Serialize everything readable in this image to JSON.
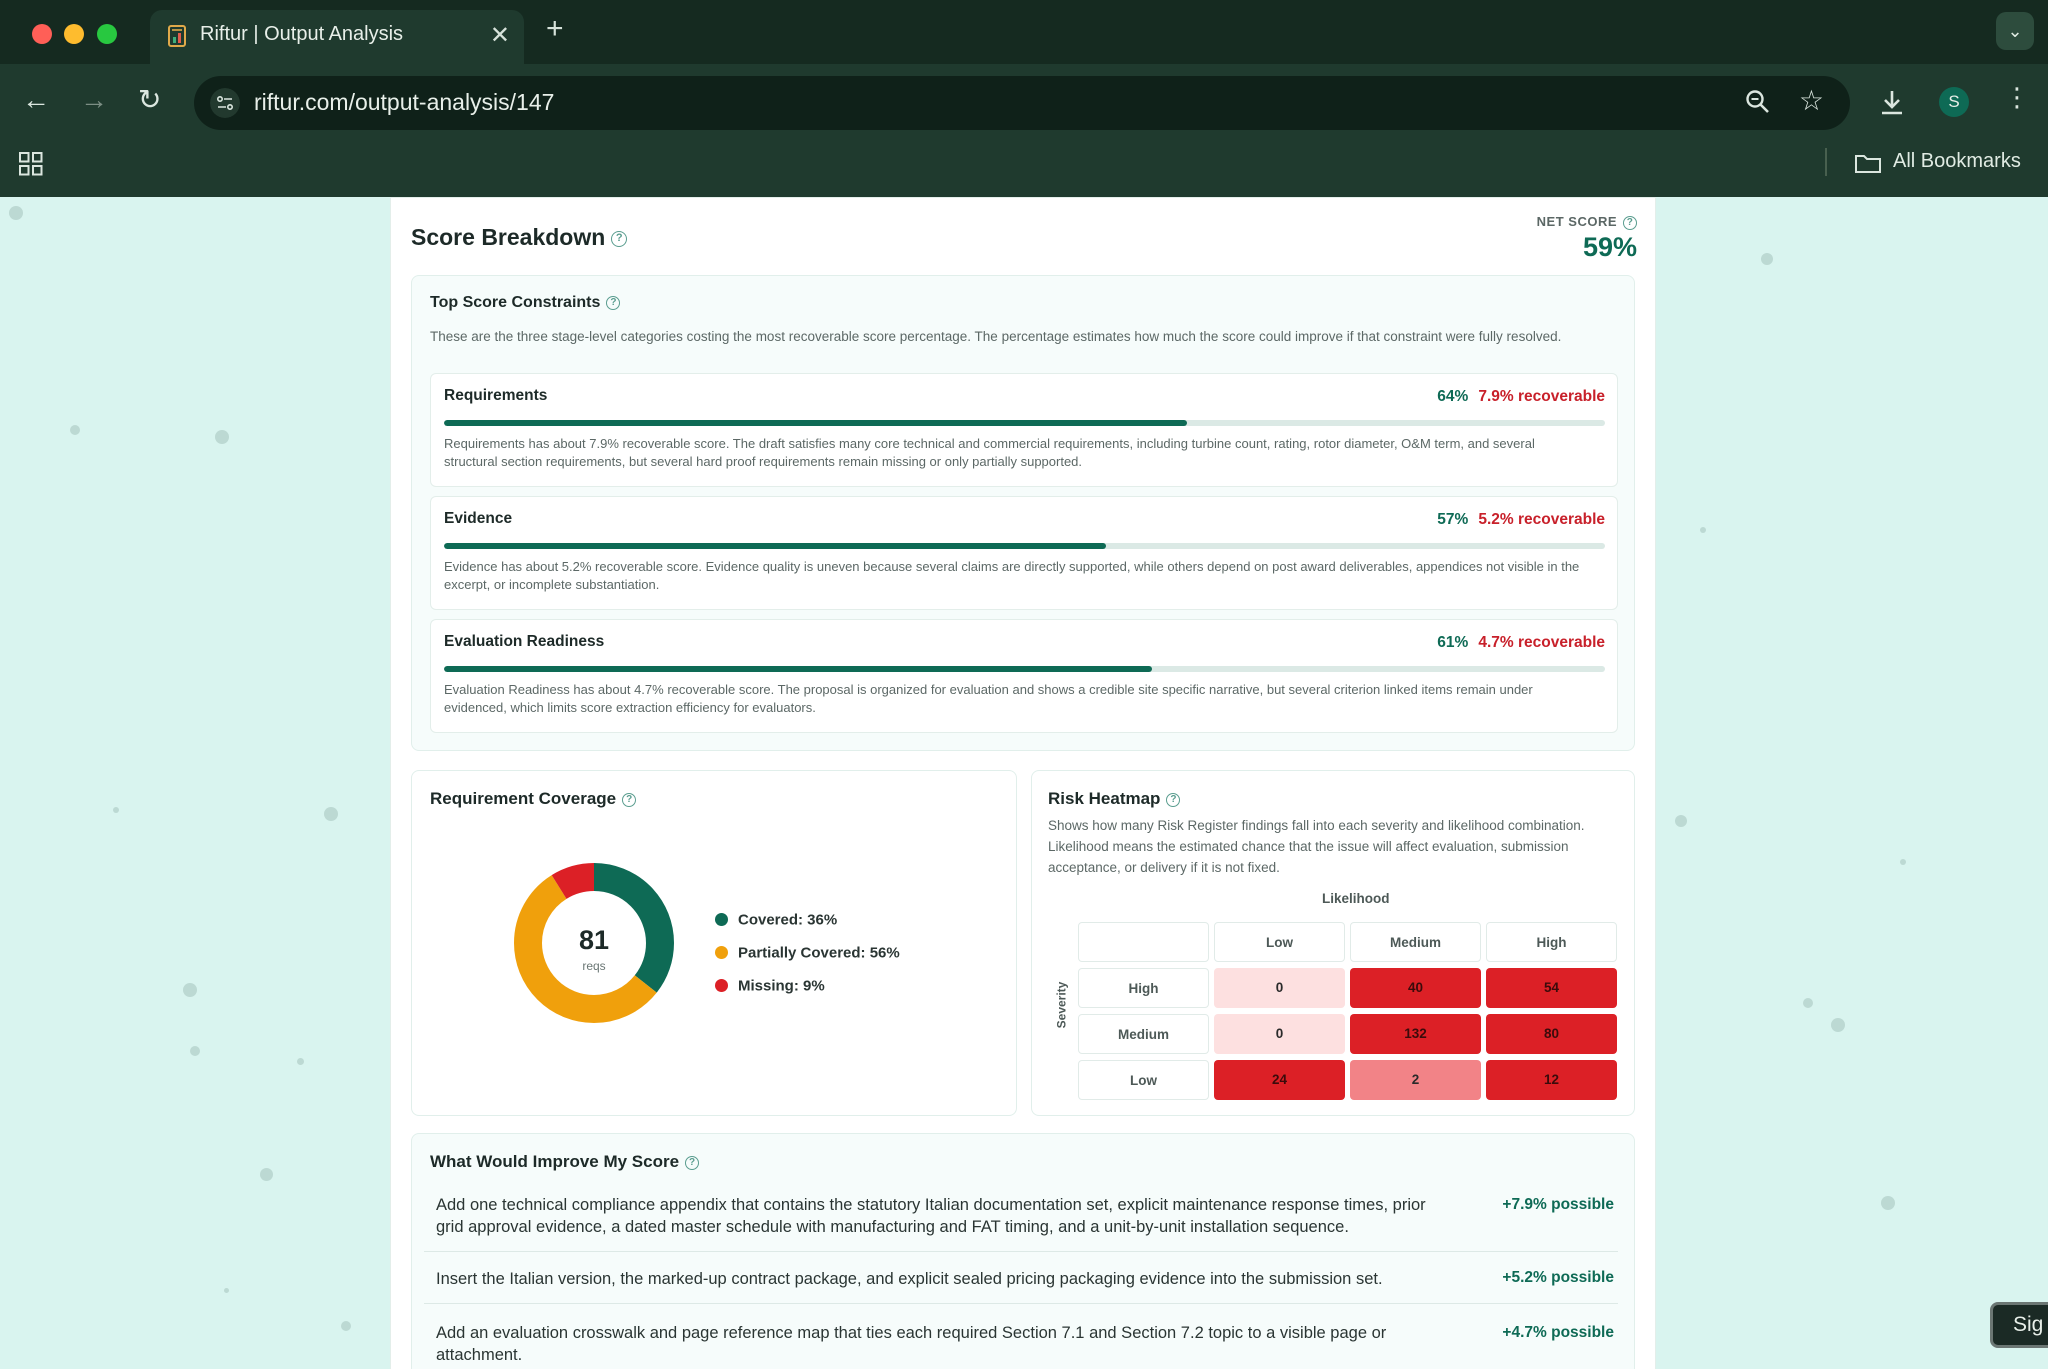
{
  "browser": {
    "tab_title": "Riftur | Output Analysis",
    "url": "riftur.com/output-analysis/147",
    "profile_initial": "S",
    "bookmarks_label": "All Bookmarks"
  },
  "score": {
    "title": "Score Breakdown",
    "net_label": "NET SCORE",
    "net_value": "59%"
  },
  "constraints": {
    "title": "Top Score Constraints",
    "description": "These are the three stage-level categories costing the most recoverable score percentage. The percentage estimates how much the score could improve if that constraint were fully resolved.",
    "items": [
      {
        "name": "Requirements",
        "percent": "64%",
        "recoverable": "7.9% recoverable",
        "progress": 0.64,
        "text": "Requirements has about 7.9% recoverable score. The draft satisfies many core technical and commercial requirements, including turbine count, rating, rotor diameter, O&M term, and several structural section requirements, but several hard proof requirements remain missing or only partially supported."
      },
      {
        "name": "Evidence",
        "percent": "57%",
        "recoverable": "5.2% recoverable",
        "progress": 0.57,
        "text": "Evidence has about 5.2% recoverable score. Evidence quality is uneven because several claims are directly supported, while others depend on post award deliverables, appendices not visible in the excerpt, or incomplete substantiation."
      },
      {
        "name": "Evaluation Readiness",
        "percent": "61%",
        "recoverable": "4.7% recoverable",
        "progress": 0.61,
        "text": "Evaluation Readiness has about 4.7% recoverable score. The proposal is organized for evaluation and shows a credible site specific narrative, but several criterion linked items remain under evidenced, which limits score extraction efficiency for evaluators."
      }
    ]
  },
  "coverage": {
    "title": "Requirement Coverage",
    "total": "81",
    "unit": "reqs",
    "legend": [
      {
        "label": "Covered: 36%",
        "color": "#0e6a55"
      },
      {
        "label": "Partially Covered: 56%",
        "color": "#f0a00c"
      },
      {
        "label": "Missing: 9%",
        "color": "#dc2026"
      }
    ]
  },
  "chart_data": {
    "type": "pie",
    "categories": [
      "Covered",
      "Partially Covered",
      "Missing"
    ],
    "values": [
      36,
      56,
      9
    ],
    "colors": [
      "#0e6a55",
      "#f0a00c",
      "#dc2026"
    ]
  },
  "heatmap": {
    "title": "Risk Heatmap",
    "description": "Shows how many Risk Register findings fall into each severity and likelihood combination. Likelihood means the estimated chance that the issue will affect evaluation, submission acceptance, or delivery if it is not fixed.",
    "x_label": "Likelihood",
    "y_label": "Severity",
    "columns": [
      "Low",
      "Medium",
      "High"
    ],
    "rows": [
      {
        "label": "High",
        "values": [
          "0",
          "40",
          "54"
        ]
      },
      {
        "label": "Medium",
        "values": [
          "0",
          "132",
          "80"
        ]
      },
      {
        "label": "Low",
        "values": [
          "24",
          "2",
          "12"
        ]
      }
    ]
  },
  "improve": {
    "title": "What Would Improve My Score",
    "items": [
      {
        "text": "Add one technical compliance appendix that contains the statutory Italian documentation set, explicit maintenance response times, prior grid approval evidence, a dated master schedule with manufacturing and FAT timing, and a unit-by-unit installation sequence.",
        "gain": "+7.9% possible"
      },
      {
        "text": "Insert the Italian version, the marked-up contract package, and explicit sealed pricing packaging evidence into the submission set.",
        "gain": "+5.2% possible"
      },
      {
        "text": "Add an evaluation crosswalk and page reference map that ties each required Section 7.1 and Section 7.2 topic to a visible page or attachment.",
        "gain": "+4.7% possible"
      }
    ]
  },
  "sign_button": "Sig"
}
